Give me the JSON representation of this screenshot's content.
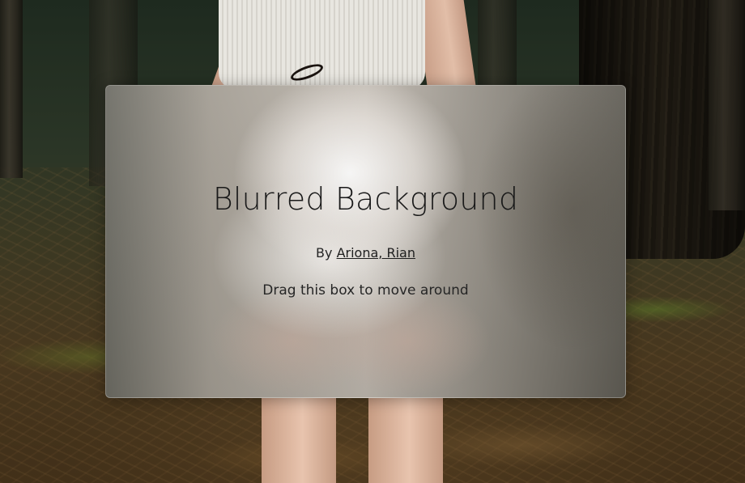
{
  "card": {
    "title": "Blurred Background",
    "byline_prefix": "By",
    "author_link": "Ariona, Rian",
    "instructions": "Drag this box to move around"
  },
  "colors": {
    "text": "#1a1a1a",
    "card_tint": "#bcb5ac"
  }
}
